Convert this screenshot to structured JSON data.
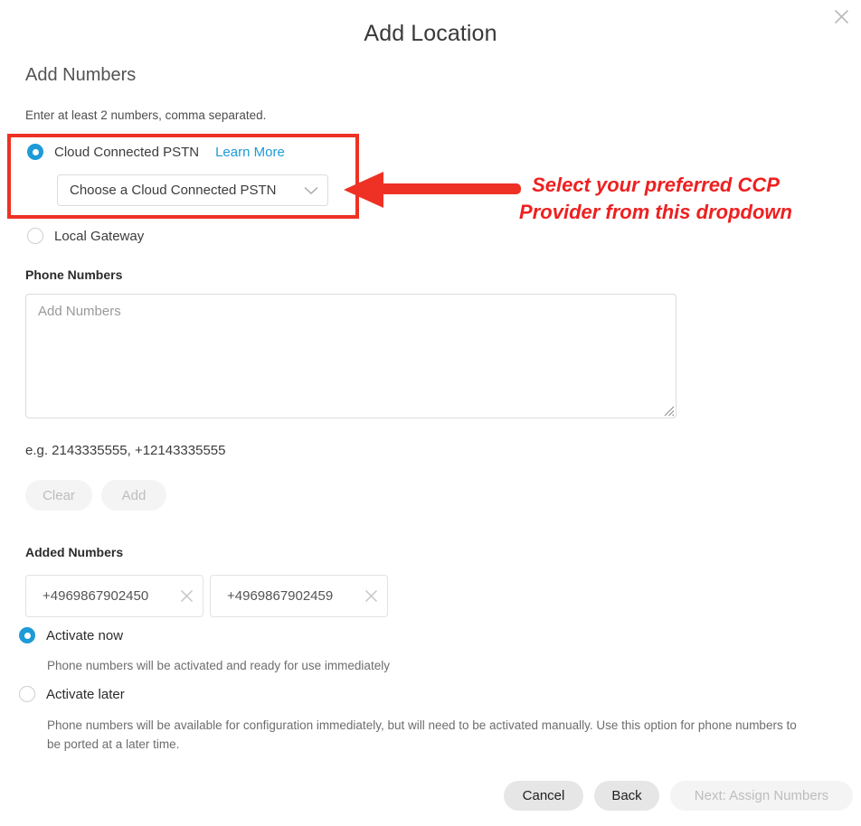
{
  "dialog": {
    "title": "Add Location",
    "close_icon": "close-icon"
  },
  "section": {
    "heading": "Add Numbers",
    "subtitle": "Enter at least 2 numbers, comma separated."
  },
  "pstn": {
    "radio_label": "Cloud Connected PSTN",
    "learn_more": "Learn More",
    "select_value": "Choose a Cloud Connected PSTN",
    "chevron_icon": "chevron-down-icon",
    "local_gateway_label": "Local Gateway",
    "selected": "cloud-connected-pstn"
  },
  "annotation": {
    "line1": "Select your preferred CCP",
    "line2": "Provider from this dropdown",
    "color": "#ee2020",
    "box_color": "#ee3124"
  },
  "phone_numbers": {
    "label": "Phone Numbers",
    "textarea_value": "",
    "textarea_placeholder": "Add Numbers",
    "hint": "e.g. 2143335555, +12143335555",
    "clear_label": "Clear",
    "add_label": "Add"
  },
  "added_numbers": {
    "label": "Added Numbers",
    "chips": [
      {
        "value": "+4969867902450",
        "remove_icon": "close-icon"
      },
      {
        "value": "+4969867902459",
        "remove_icon": "close-icon"
      }
    ]
  },
  "activation": {
    "selected": "activate-now",
    "now_label": "Activate now",
    "now_description": "Phone numbers will be activated and ready for use immediately",
    "later_label": "Activate later",
    "later_description": "Phone numbers will be available for configuration immediately, but will need to be activated manually. Use this option for phone numbers to be ported at a later time."
  },
  "footer": {
    "cancel_label": "Cancel",
    "back_label": "Back",
    "next_label": "Next: Assign Numbers"
  },
  "colors": {
    "accent": "#1d9bd7",
    "annotation_red": "#ee2020",
    "link": "#1d9bd7"
  }
}
